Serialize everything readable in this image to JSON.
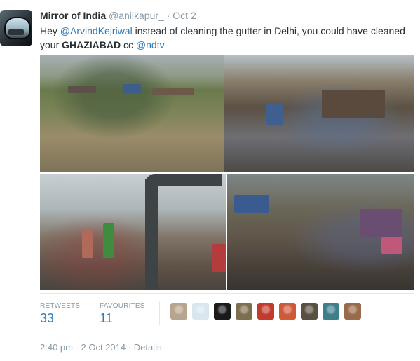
{
  "tweet": {
    "name": "Mirror of India",
    "handle": "@anilkapur_",
    "separator": "·",
    "date": "Oct 2",
    "text_parts": {
      "t1": "Hey ",
      "m1": "@ArvindKejriwal",
      "t2": " instead of cleaning the gutter in Delhi, you could have cleaned your ",
      "caps": "GHAZIABAD",
      "t3": " cc ",
      "m2": "@ndtv"
    }
  },
  "stats": {
    "retweets_label": "RETWEETS",
    "retweets_value": "33",
    "favourites_label": "FAVOURITES",
    "favourites_value": "11"
  },
  "favouriter_avatars": [
    {
      "color": "#b7a48e"
    },
    {
      "color": "#d8e6ee"
    },
    {
      "color": "#1a1a1a"
    },
    {
      "color": "#7d6e4e"
    },
    {
      "color": "#c23a2e"
    },
    {
      "color": "#cf5a3a"
    },
    {
      "color": "#5a5042"
    },
    {
      "color": "#3f7f8a"
    },
    {
      "color": "#9a6b4a"
    }
  ],
  "footer": {
    "timestamp": "2:40 pm - 2 Oct 2014",
    "separator": "·",
    "details": "Details"
  },
  "colors": {
    "link": "#2b7bb9",
    "muted": "#8899a6",
    "text": "#292f33"
  }
}
